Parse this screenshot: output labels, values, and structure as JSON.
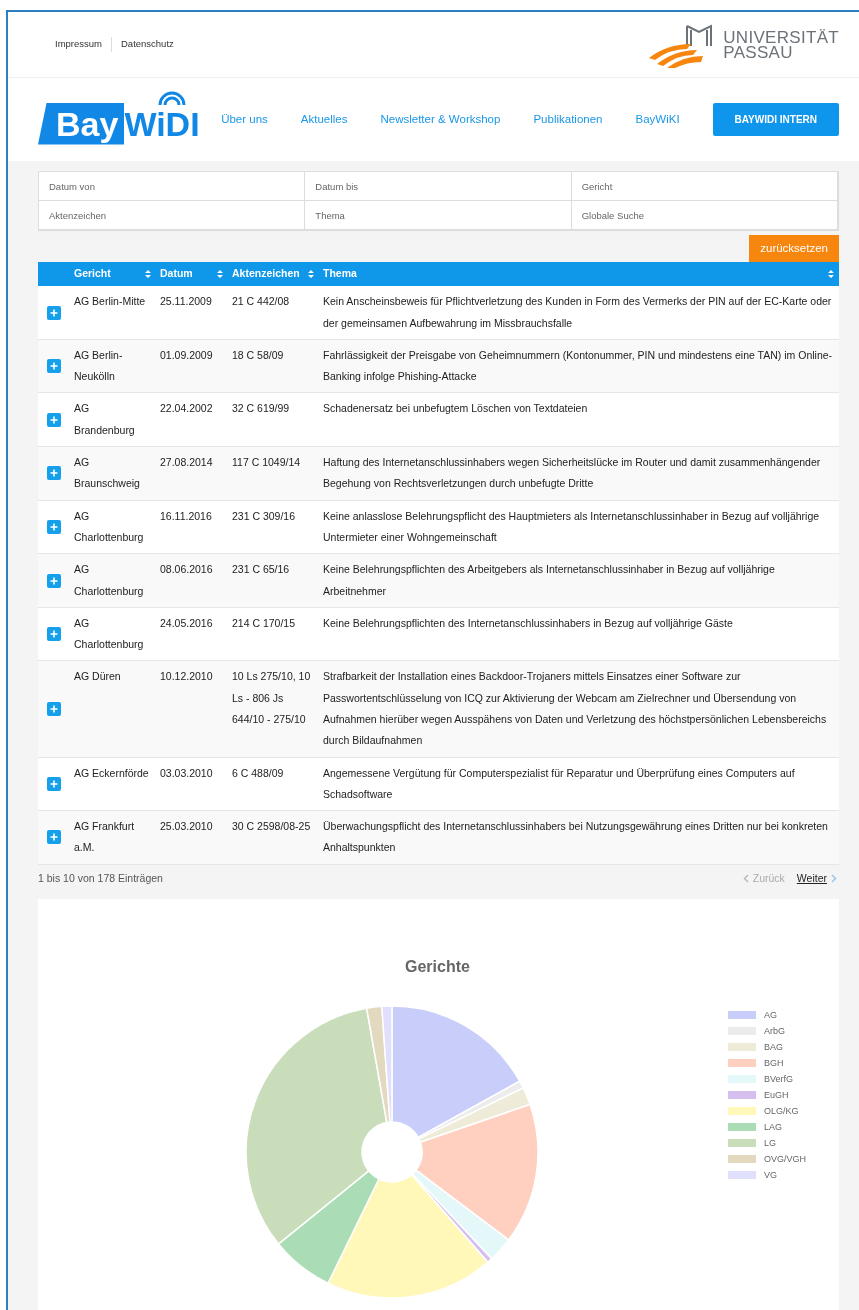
{
  "top_links": [
    {
      "label": "Impressum"
    },
    {
      "label": "Datenschutz"
    }
  ],
  "university_logo": {
    "line1": "UNIVERSITÄT",
    "line2": "PASSAU"
  },
  "site_logo": {
    "part1": "Bay",
    "part2": "WiDI"
  },
  "nav": [
    {
      "label": "Über uns",
      "kind": "link"
    },
    {
      "label": "Aktuelles",
      "kind": "link"
    },
    {
      "label": "Newsletter & Workshop",
      "kind": "link"
    },
    {
      "label": "Publikationen",
      "kind": "link"
    },
    {
      "label": "BayWiKI",
      "kind": "link"
    },
    {
      "label": "BAYWIDI INTERN",
      "kind": "button"
    }
  ],
  "filters": [
    {
      "placeholder": "Datum von"
    },
    {
      "placeholder": "Datum bis"
    },
    {
      "placeholder": "Gericht"
    },
    {
      "placeholder": "Aktenzeichen"
    },
    {
      "placeholder": "Thema"
    },
    {
      "placeholder": "Globale Suche"
    }
  ],
  "reset_button": "zurücksetzen",
  "table": {
    "columns": [
      "Gericht",
      "Datum",
      "Aktenzeichen",
      "Thema"
    ],
    "rows": [
      {
        "gericht": "AG Berlin-Mitte",
        "datum": "25.11.2009",
        "aktenzeichen": "21 C 442/08",
        "thema": "Kein Anscheinsbeweis für Pflichtverletzung des Kunden in Form des Vermerks der PIN auf der EC-Karte oder der gemeinsamen Aufbewahrung im Missbrauchsfalle"
      },
      {
        "gericht": "AG Berlin-Neukölln",
        "datum": "01.09.2009",
        "aktenzeichen": "18 C 58/09",
        "thema": "Fahrlässigkeit der Preisgabe von Geheimnummern (Kontonummer, PIN und mindestens eine TAN) im Online-Banking infolge Phishing-Attacke"
      },
      {
        "gericht": "AG Brandenburg",
        "datum": "22.04.2002",
        "aktenzeichen": "32 C 619/99",
        "thema": "Schadenersatz bei unbefugtem Löschen von Textdateien"
      },
      {
        "gericht": "AG Braunschweig",
        "datum": "27.08.2014",
        "aktenzeichen": "117 C 1049/14",
        "thema": "Haftung des Internetanschlussinhabers wegen Sicherheitslücke im Router und damit zusammenhängender Begehung von Rechtsverletzungen durch unbefugte Dritte"
      },
      {
        "gericht": "AG Charlottenburg",
        "datum": "16.11.2016",
        "aktenzeichen": "231 C 309/16",
        "thema": "Keine anlasslose Belehrungspflicht des Hauptmieters als Internetanschlussinhaber in Bezug auf volljährige Untermieter einer Wohngemeinschaft"
      },
      {
        "gericht": "AG Charlottenburg",
        "datum": "08.06.2016",
        "aktenzeichen": "231 C 65/16",
        "thema": "Keine Belehrungspflichten des Arbeitgebers als Internetanschlussinhaber in Bezug auf volljährige Arbeitnehmer"
      },
      {
        "gericht": "AG Charlottenburg",
        "datum": "24.05.2016",
        "aktenzeichen": "214 C 170/15",
        "thema": "Keine Belehrungspflichten des Internetanschlussinhabers in Bezug auf volljährige Gäste"
      },
      {
        "gericht": "AG Düren",
        "datum": "10.12.2010",
        "aktenzeichen": "10 Ls 275/10, 10 Ls - 806 Js 644/10 - 275/10",
        "thema": "Strafbarkeit der Installation eines Backdoor-Trojaners mittels Einsatzes einer Software zur Passwortentschlüsselung von ICQ zur Aktivierung der Webcam am Zielrechner und Übersendung von Aufnahmen hierüber wegen Ausspähens von Daten und Verletzung des höchstpersönlichen Lebensbereichs durch Bildaufnahmen"
      },
      {
        "gericht": "AG Eckernförde",
        "datum": "03.03.2010",
        "aktenzeichen": "6 C 488/09",
        "thema": "Angemessene Vergütung für Computerspezialist für Reparatur und Überprüfung eines Computers auf Schadsoftware"
      },
      {
        "gericht": "AG Frankfurt a.M.",
        "datum": "25.03.2010",
        "aktenzeichen": "30 C 2598/08-25",
        "thema": "Überwachungspflicht des Internetanschlussinhabers bei Nutzungsgewährung eines Dritten nur bei konkreten Anhaltspunkten"
      }
    ]
  },
  "table_info": "1 bis 10 von 178 Einträgen",
  "pagination": [
    {
      "label": "Zurück",
      "kind": "prev",
      "disabled": true
    },
    {
      "label": "Weiter",
      "kind": "next",
      "disabled": false
    }
  ],
  "chart": {
    "title": "Gerichte",
    "legend": [
      {
        "label": "AG",
        "color": "#c8cdfa"
      },
      {
        "label": "ArbG",
        "color": "#ececec"
      },
      {
        "label": "BAG",
        "color": "#eeecd8"
      },
      {
        "label": "BGH",
        "color": "#ffcfc0"
      },
      {
        "label": "BVerfG",
        "color": "#e4f8fa"
      },
      {
        "label": "EuGH",
        "color": "#d4bfee"
      },
      {
        "label": "OLG/KG",
        "color": "#fff8b8"
      },
      {
        "label": "LAG",
        "color": "#aadcb6"
      },
      {
        "label": "LG",
        "color": "#c9ddbb"
      },
      {
        "label": "OVG/VGH",
        "color": "#e2d9be"
      },
      {
        "label": "VG",
        "color": "#e0dffc"
      }
    ]
  }
}
